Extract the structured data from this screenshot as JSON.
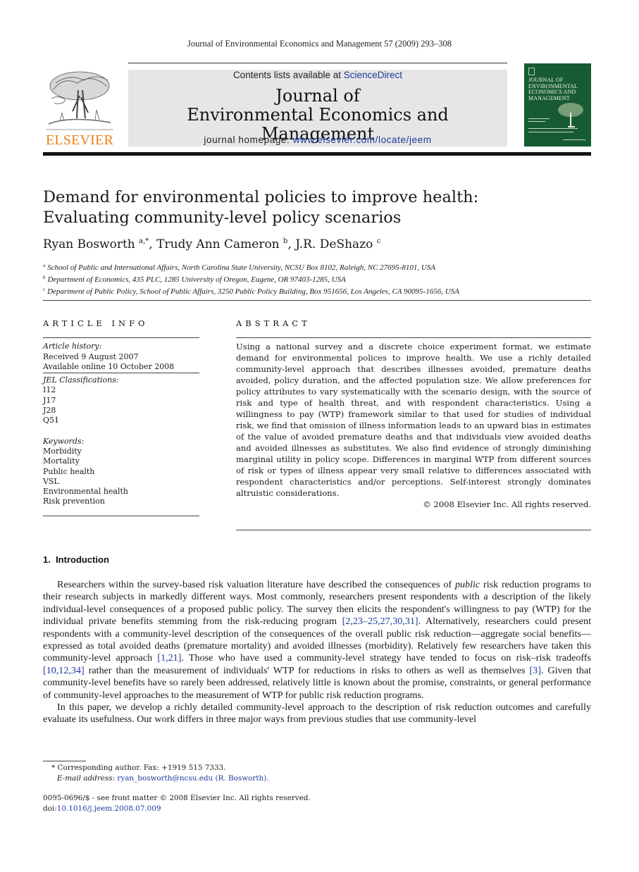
{
  "running_head": "Journal of Environmental Economics and Management 57 (2009) 293–308",
  "masthead": {
    "publisher_wordmark": "ELSEVIER",
    "contents_prefix": "Contents lists available at ",
    "contents_link": "ScienceDirect",
    "journal_title_line1": "Journal of",
    "journal_title_line2": "Environmental Economics and Management",
    "homepage_prefix": "journal homepage: ",
    "homepage_link": "www.elsevier.com/locate/jeem",
    "cover_title": [
      "JOURNAL OF",
      "ENVIRONMENTAL",
      "ECONOMICS AND",
      "MANAGEMENT"
    ],
    "colors": {
      "elsevier_orange": "#f07d18",
      "link_blue": "#1c3a9a",
      "cover_green": "#175b32",
      "banner_grey": "#e6e6e6"
    }
  },
  "article": {
    "title_line1": "Demand for environmental policies to improve health:",
    "title_line2": "Evaluating community-level policy scenarios",
    "authors": [
      {
        "name": "Ryan Bosworth",
        "marks": "a,*",
        "sep": ", "
      },
      {
        "name": "Trudy Ann Cameron",
        "marks": "b",
        "sep": ", "
      },
      {
        "name": "J.R. DeShazo",
        "marks": "c",
        "sep": ""
      }
    ],
    "affiliations": [
      {
        "mark": "a",
        "text": "School of Public and International Affairs, North Carolina State University, NCSU Box 8102, Raleigh, NC 27695-8101, USA"
      },
      {
        "mark": "b",
        "text": "Department of Economics, 435 PLC, 1285 University of Oregon, Eugene, OR 97403-1285, USA"
      },
      {
        "mark": "c",
        "text": "Department of Public Policy, School of Public Affairs, 3250 Public Policy Building, Box 951656, Los Angeles, CA 90095-1656, USA"
      }
    ]
  },
  "article_info": {
    "heading": "ARTICLE INFO",
    "history_label": "Article history:",
    "received": "Received 9 August 2007",
    "available_online": "Available online 10 October 2008",
    "jel_label": "JEL Classifications:",
    "jel_codes": [
      "I12",
      "J17",
      "J28",
      "Q51"
    ],
    "keywords_label": "Keywords:",
    "keywords": [
      "Morbidity",
      "Mortality",
      "Public health",
      "VSL",
      "Environmental health",
      "Risk prevention"
    ]
  },
  "abstract": {
    "heading": "ABSTRACT",
    "text": "Using a national survey and a discrete choice experiment format, we estimate demand for environmental polices to improve health. We use a richly detailed community-level approach that describes illnesses avoided, premature deaths avoided, policy duration, and the affected population size. We allow preferences for policy attributes to vary systematically with the scenario design, with the source of risk and type of health threat, and with respondent characteristics. Using a willingness to pay (WTP) framework similar to that used for studies of individual risk, we find that omission of illness information leads to an upward bias in estimates of the value of avoided premature deaths and that individuals view avoided deaths and avoided illnesses as substitutes. We also find evidence of strongly diminishing marginal utility in policy scope. Differences in marginal WTP from different sources of risk or types of illness appear very small relative to differences associated with respondent characteristics and/or perceptions. Self-interest strongly dominates altruistic considerations.",
    "copyright": "© 2008 Elsevier Inc. All rights reserved."
  },
  "introduction": {
    "heading": "1.  Introduction",
    "p1": {
      "a": "Researchers within the survey-based risk valuation literature have described the consequences of ",
      "em": "public",
      "b": " risk reduction programs to their research subjects in markedly different ways. Most commonly, researchers present respondents with a description of the likely individual-level consequences of a proposed public policy. The survey then elicits the respondent's willingness to pay (WTP) for the individual private benefits stemming from the risk-reducing program ",
      "ref1": "[2,23–25,27,30,31]",
      "c": ". Alternatively, researchers could present respondents with a community-level description of the consequences of the overall public risk reduction—aggregate social benefits—expressed as total avoided deaths (premature mortality) and avoided illnesses (morbidity). Relatively few researchers have taken this community-level approach ",
      "ref2": "[1,21]",
      "d": ". Those who have used a community-level strategy have tended to focus on risk–risk tradeoffs ",
      "ref3": "[10,12,34]",
      "e": " rather than the measurement of individuals' WTP for reductions in risks to others as well as themselves ",
      "ref4": "[3]",
      "f": ". Given that community-level benefits have so rarely been addressed, relatively little is known about the promise, constraints, or general performance of community-level approaches to the measurement of WTP for public risk reduction programs."
    },
    "p2": "In this paper, we develop a richly detailed community-level approach to the description of risk reduction outcomes and carefully evaluate its usefulness. Our work differs in three major ways from previous studies that use community-level"
  },
  "footnotes": {
    "corresponding": "* Corresponding author. Fax: +1919 515 7333.",
    "email_label": "E-mail address: ",
    "email": "ryan_bosworth@ncsu.edu (R. Bosworth).",
    "front_matter": "0095-0696/$ - see front matter © 2008 Elsevier Inc. All rights reserved.",
    "doi_prefix": "doi:",
    "doi": "10.1016/j.jeem.2008.07.009"
  }
}
